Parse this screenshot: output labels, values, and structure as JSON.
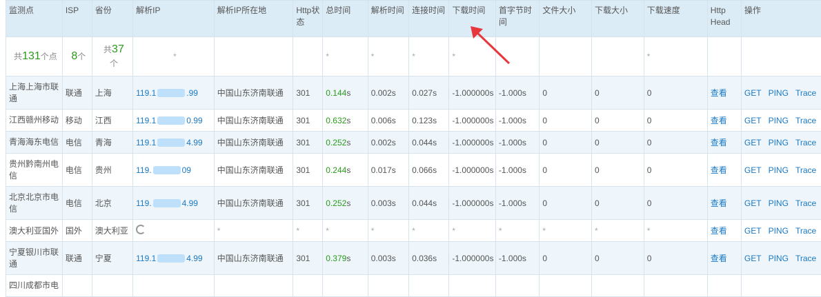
{
  "headers": {
    "monitor": "监测点",
    "isp": "ISP",
    "province": "省份",
    "ip": "解析IP",
    "ip_location": "解析IP所在地",
    "http_status": "Http状态",
    "total_time": "总时间",
    "resolve_time": "解析时间",
    "connect_time": "连接时间",
    "download_time": "下载时间",
    "first_byte": "首字节时间",
    "file_size": "文件大小",
    "download_size": "下载大小",
    "download_speed": "下载速度",
    "http_head": "Http Head",
    "actions": "操作"
  },
  "summary": {
    "monitor_prefix": "共",
    "monitor_count": "131",
    "monitor_suffix": "个点",
    "isp_count": "8",
    "isp_suffix": "个",
    "province_prefix": "共",
    "province_count": "37",
    "province_suffix": "个",
    "star": "*"
  },
  "rows": [
    {
      "monitor": "上海上海市联通",
      "isp": "联通",
      "province": "上海",
      "ip_a": "119.1",
      "ip_b": ".99",
      "loc": "中国山东济南联通",
      "status": "301",
      "total": "0.144",
      "unit": "s",
      "resolve": "0.002s",
      "connect": "0.027s",
      "download": "-1.000000s",
      "first": "-1.000s",
      "fsize": "0",
      "dsize": "0",
      "speed": "0",
      "head": "查看",
      "get": "GET",
      "ping": "PING",
      "trace": "Trace"
    },
    {
      "monitor": "江西赣州移动",
      "isp": "移动",
      "province": "江西",
      "ip_a": "119.1",
      "ip_b": "0.99",
      "loc": "中国山东济南联通",
      "status": "301",
      "total": "0.632",
      "unit": "s",
      "resolve": "0.006s",
      "connect": "0.123s",
      "download": "-1.000000s",
      "first": "-1.000s",
      "fsize": "0",
      "dsize": "0",
      "speed": "0",
      "head": "查看",
      "get": "GET",
      "ping": "PING",
      "trace": "Trace"
    },
    {
      "monitor": "青海海东电信",
      "isp": "电信",
      "province": "青海",
      "ip_a": "119.1",
      "ip_b": "4.99",
      "loc": "中国山东济南联通",
      "status": "301",
      "total": "0.252",
      "unit": "s",
      "resolve": "0.002s",
      "connect": "0.044s",
      "download": "-1.000000s",
      "first": "-1.000s",
      "fsize": "0",
      "dsize": "0",
      "speed": "0",
      "head": "查看",
      "get": "GET",
      "ping": "PING",
      "trace": "Trace"
    },
    {
      "monitor": "贵州黔南州电信",
      "isp": "电信",
      "province": "贵州",
      "ip_a": "119.",
      "ip_b": "09",
      "loc": "中国山东济南联通",
      "status": "301",
      "total": "0.244",
      "unit": "s",
      "resolve": "0.017s",
      "connect": "0.066s",
      "download": "-1.000000s",
      "first": "-1.000s",
      "fsize": "0",
      "dsize": "0",
      "speed": "0",
      "head": "查看",
      "get": "GET",
      "ping": "PING",
      "trace": "Trace"
    },
    {
      "monitor": "北京北京市电信",
      "isp": "电信",
      "province": "北京",
      "ip_a": "119.",
      "ip_b": "4.99",
      "loc": "中国山东济南联通",
      "status": "301",
      "total": "0.252",
      "unit": "s",
      "resolve": "0.003s",
      "connect": "0.044s",
      "download": "-1.000000s",
      "first": "-1.000s",
      "fsize": "0",
      "dsize": "0",
      "speed": "0",
      "head": "查看",
      "get": "GET",
      "ping": "PING",
      "trace": "Trace"
    },
    {
      "monitor": "宁夏银川市联通",
      "isp": "联通",
      "province": "宁夏",
      "ip_a": "119.1",
      "ip_b": "4.99",
      "loc": "中国山东济南联通",
      "status": "301",
      "total": "0.379",
      "unit": "s",
      "resolve": "0.003s",
      "connect": "0.036s",
      "download": "-1.000000s",
      "first": "-1.000s",
      "fsize": "0",
      "dsize": "0",
      "speed": "0",
      "head": "查看",
      "get": "GET",
      "ping": "PING",
      "trace": "Trace"
    }
  ],
  "overseas_row": {
    "monitor": "澳大利亚国外",
    "isp": "国外",
    "province": "澳大利亚",
    "star": "*",
    "head": "查看",
    "get": "GET",
    "ping": "PING",
    "trace": "Trace"
  },
  "partial_row": {
    "monitor": "四川成都市电"
  },
  "colors": {
    "header_bg": "#dcecf6",
    "row_alt": "#eef6fb",
    "link": "#1a78c2",
    "green": "#2a9a1a",
    "arrow": "#e8363d"
  }
}
